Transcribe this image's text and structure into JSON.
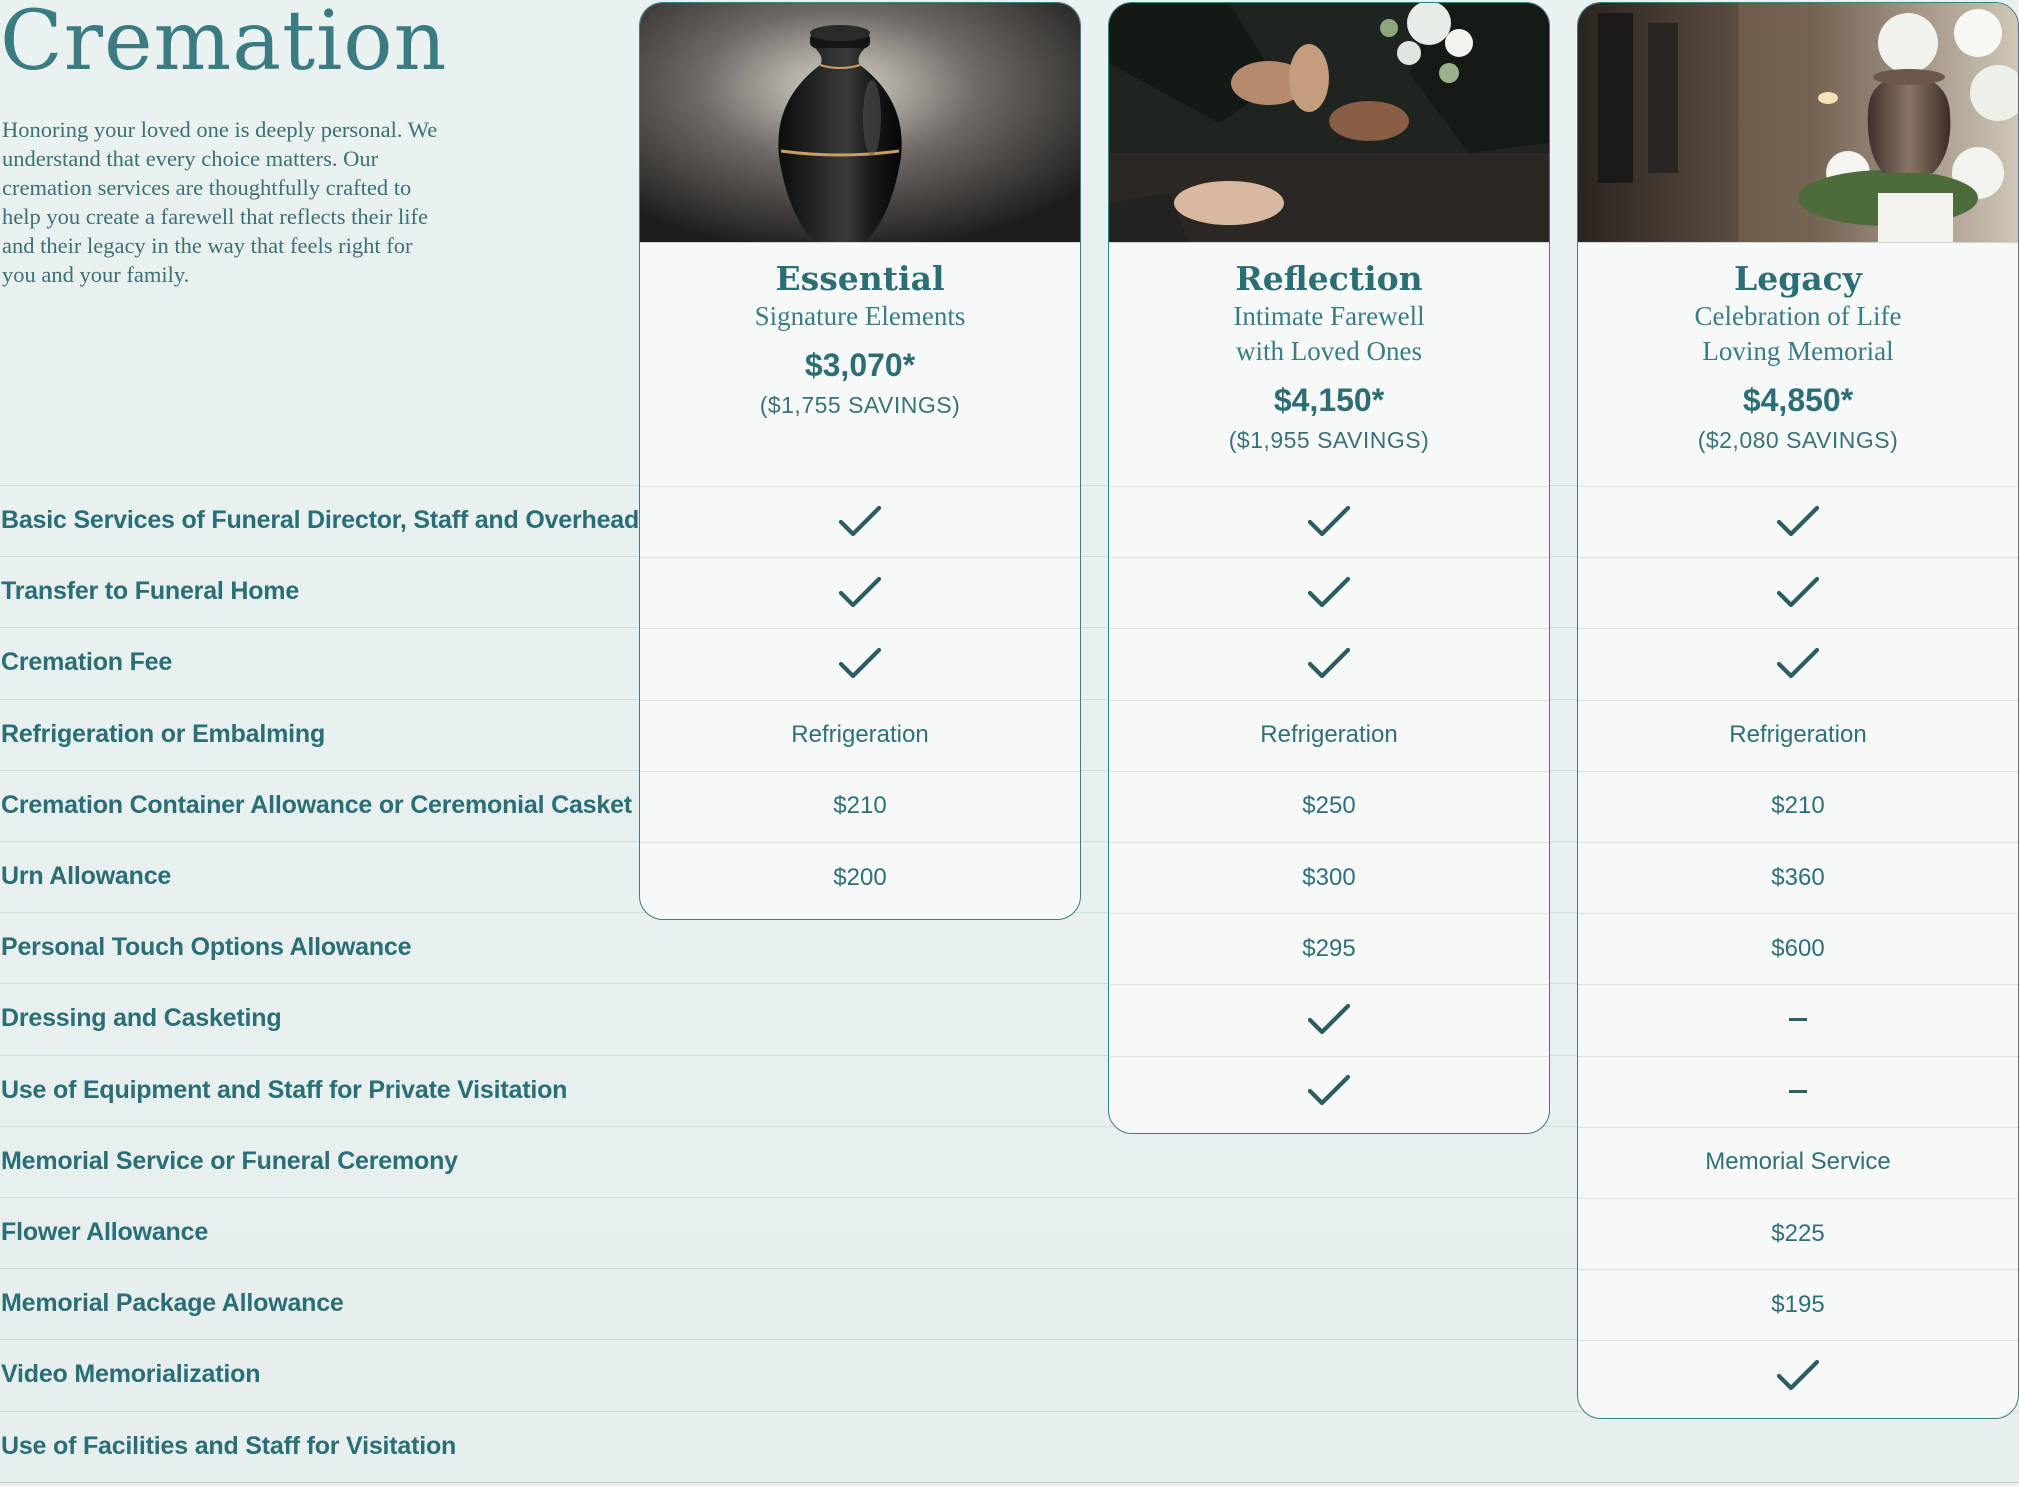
{
  "page": {
    "title": "Cremation",
    "intro": "Honoring your loved one is deeply personal. We understand that every choice matters. Our cremation services are thoughtfully crafted to help you create a farewell that reflects their life and their legacy in the way that feels right for you and your family."
  },
  "colors": {
    "accent": "#2b6e74",
    "background": "#e9f1f1",
    "card": "#f7f9f9",
    "border": "#3f7d83"
  },
  "packages": [
    {
      "name": "Essential",
      "subtitle_1": "Signature Elements",
      "subtitle_2": "",
      "price": "$3,070*",
      "savings": "($1,755 SAVINGS)",
      "image": "black-urn-photo"
    },
    {
      "name": "Reflection",
      "subtitle_1": "Intimate Farewell",
      "subtitle_2": "with Loved Ones",
      "price": "$4,150*",
      "savings": "($1,955 SAVINGS)",
      "image": "hands-on-casket-photo"
    },
    {
      "name": "Legacy",
      "subtitle_1": "Celebration of Life",
      "subtitle_2": "Loving Memorial",
      "price": "$4,850*",
      "savings": "($2,080 SAVINGS)",
      "image": "urn-with-flowers-photo"
    }
  ],
  "features": [
    {
      "label": "Basic Services of Funeral Director, Staff and Overhead",
      "values": [
        "check",
        "check",
        "check"
      ]
    },
    {
      "label": "Transfer to Funeral Home",
      "values": [
        "check",
        "check",
        "check"
      ]
    },
    {
      "label": "Cremation Fee",
      "values": [
        "check",
        "check",
        "check"
      ]
    },
    {
      "label": "Refrigeration or Embalming",
      "values": [
        "Refrigeration",
        "Refrigeration",
        "Refrigeration"
      ]
    },
    {
      "label": "Cremation Container Allowance or Ceremonial Casket",
      "values": [
        "$210",
        "$250",
        "$210"
      ]
    },
    {
      "label": "Urn Allowance",
      "values": [
        "$200",
        "$300",
        "$360"
      ]
    },
    {
      "label": "Personal Touch Options Allowance",
      "values": [
        null,
        "$295",
        "$600"
      ]
    },
    {
      "label": "Dressing and Casketing",
      "values": [
        null,
        "check",
        "dash"
      ]
    },
    {
      "label": "Use of Equipment and Staff for Private Visitation",
      "values": [
        null,
        "check",
        "dash"
      ]
    },
    {
      "label": "Memorial Service or Funeral Ceremony",
      "values": [
        null,
        null,
        "Memorial Service"
      ]
    },
    {
      "label": "Flower Allowance",
      "values": [
        null,
        null,
        "$225"
      ]
    },
    {
      "label": "Memorial Package Allowance",
      "values": [
        null,
        null,
        "$195"
      ]
    },
    {
      "label": "Video Memorialization",
      "values": [
        null,
        null,
        "check"
      ]
    },
    {
      "label": "Use of Facilities and Staff for Visitation",
      "values": [
        null,
        null,
        null
      ]
    }
  ]
}
